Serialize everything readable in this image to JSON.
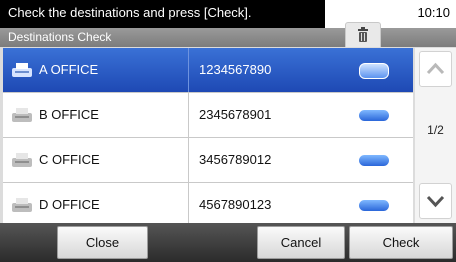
{
  "status_bar": {
    "message": "Check the destinations and press [Check].",
    "time": "10:10"
  },
  "header": {
    "title": "Destinations Check"
  },
  "destinations": [
    {
      "name": "A OFFICE",
      "number": "1234567890",
      "selected": true
    },
    {
      "name": "B OFFICE",
      "number": "2345678901",
      "selected": false
    },
    {
      "name": "C OFFICE",
      "number": "3456789012",
      "selected": false
    },
    {
      "name": "D OFFICE",
      "number": "4567890123",
      "selected": false
    }
  ],
  "pagination": {
    "page": "1/2"
  },
  "buttons": {
    "close": "Close",
    "cancel": "Cancel",
    "check": "Check"
  },
  "colors": {
    "selected_row": "#2a5cc7",
    "title_bar": "#8a8a8a",
    "bottom_bar": "#3a3a3a"
  }
}
